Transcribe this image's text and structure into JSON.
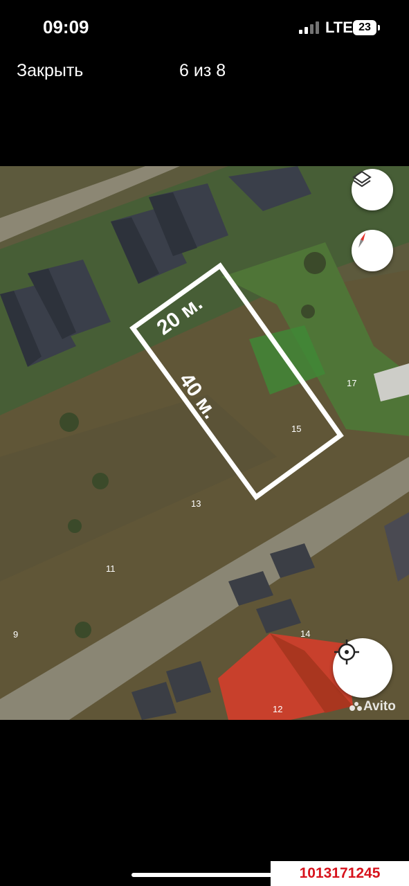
{
  "status_bar": {
    "time": "09:09",
    "network": "LTE",
    "battery": "23"
  },
  "header": {
    "close_label": "Закрыть",
    "counter": "6 из 8"
  },
  "map": {
    "plot_width_label": "20 м.",
    "plot_length_label": "40 м.",
    "house_numbers": [
      "17",
      "15",
      "13",
      "11",
      "9",
      "14",
      "12"
    ],
    "watermark": "Avito",
    "layers_icon": "layers-icon",
    "compass_icon": "compass-icon",
    "locate_icon": "crosshair-icon"
  },
  "footer": {
    "ad_id": "1013171245"
  },
  "colors": {
    "accent_red": "#d7121c",
    "outline": "#ffffff",
    "roof_red": "#c8402c"
  }
}
